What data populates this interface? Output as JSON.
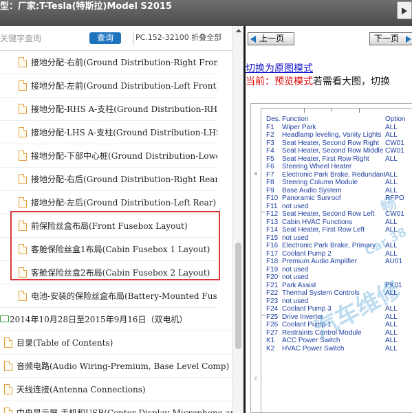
{
  "topbar": {
    "model_text": "型：厂家:T-Tesla(特斯拉)Model S2015"
  },
  "search": {
    "placeholder": "关键字查询",
    "button_label": "查询",
    "pc_info": "PC.152-32100 折叠全部"
  },
  "tree": {
    "items": [
      {
        "label": "接地分配-右前(Ground Distribution-Right Front)",
        "icon": "file-icon"
      },
      {
        "label": "接地分配-左前(Ground Distribution-Left Front)",
        "icon": "file-icon"
      },
      {
        "label": "接地分配-RHS A-支柱(Ground Distribution-RHS A)",
        "icon": "file-icon"
      },
      {
        "label": "接地分配-LHS A-支柱(Ground Distribution-LHS A)",
        "icon": "file-icon"
      },
      {
        "label": "接地分配-下部中心桩(Ground Distribution-Lower Ce",
        "icon": "file-icon"
      },
      {
        "label": "接地分配-右后(Ground Distribution-Right Rear)",
        "icon": "file-icon"
      },
      {
        "label": "接地分配-左后(Ground Distribution-Left Rear)",
        "icon": "file-icon"
      },
      {
        "label": "前保险丝盒布局(Front Fusebox Layout)",
        "icon": "file-icon"
      },
      {
        "label": "客舱保险丝盒1布局(Cabin Fusebox 1 Layout)",
        "icon": "file-icon"
      },
      {
        "label": "客舱保险丝盒2布局(Cabin Fusebox 2 Layout)",
        "icon": "file-icon"
      },
      {
        "label": "电池-安装的保险丝盒布局(Battery-Mounted Fusebox",
        "icon": "file-icon"
      },
      {
        "label": "2014年10月28日至2015年9月16日（双电机）",
        "icon": "folder-icon"
      },
      {
        "label": "目录(Table of Contents)",
        "icon": "file-icon"
      },
      {
        "label": "音频电路(Audio Wiring-Premium, Base Level Comp)",
        "icon": "file-icon"
      },
      {
        "label": "天线连接(Antenna Connections)",
        "icon": "file-icon"
      },
      {
        "label": "中央显示屏-手机和USB(Center Display-Microphone and",
        "icon": "file-icon"
      }
    ]
  },
  "pager": {
    "prev_label": "上一页",
    "next_label": "下一页"
  },
  "preview": {
    "switch_link": "切换为原图模式",
    "mode_prefix": "当前：预览模式",
    "mode_suffix": "若需看大图，切换",
    "column_number": "1",
    "row_marker_b": "B",
    "row_marker_c": "C",
    "header": {
      "des": "Des.",
      "function": "Function",
      "option": "Option"
    },
    "fuses": [
      {
        "des": "F1",
        "function": "Wiper Park",
        "option": "ALL"
      },
      {
        "des": "F2",
        "function": "Headlamp leveling, Vanity Lights",
        "option": "ALL"
      },
      {
        "des": "F3",
        "function": "Seat Heater, Second Row Right",
        "option": "CW01"
      },
      {
        "des": "F4",
        "function": "Seat Heater, Second Row Middle",
        "option": "CW01"
      },
      {
        "des": "F5",
        "function": "Seat Heater, First Row Right",
        "option": "ALL"
      },
      {
        "des": "F6",
        "function": "Steering Wheel Heater",
        "option": ""
      },
      {
        "des": "F7",
        "function": "Electronic Park Brake, Redundant",
        "option": "ALL"
      },
      {
        "des": "F8",
        "function": "Steering Column Module",
        "option": "ALL"
      },
      {
        "des": "F9",
        "function": "Base Audio System",
        "option": "ALL"
      },
      {
        "des": "F10",
        "function": "Panoramic Sunroof",
        "option": "RFPO"
      },
      {
        "des": "F11",
        "function": "not used",
        "option": ""
      },
      {
        "des": "F12",
        "function": "Seat Heater, Second Row Left",
        "option": "CW01"
      },
      {
        "des": "F13",
        "function": "Cabin HVAC Functions",
        "option": "ALL"
      },
      {
        "des": "F14",
        "function": "Seat Heater, First Row Left",
        "option": "ALL"
      },
      {
        "des": "F15",
        "function": "not used",
        "option": ""
      },
      {
        "des": "F16",
        "function": "Electronic Park Brake, Primary",
        "option": "ALL"
      },
      {
        "des": "F17",
        "function": "Coolant Pump 2",
        "option": "ALL"
      },
      {
        "des": "F18",
        "function": "Premium Audio Amplifier",
        "option": "AU01"
      },
      {
        "des": "F19",
        "function": "not used",
        "option": ""
      },
      {
        "des": "F20",
        "function": "not used",
        "option": ""
      },
      {
        "des": "F21",
        "function": "Park Assist",
        "option": "PK01"
      },
      {
        "des": "F22",
        "function": "Thermal System Controls",
        "option": "ALL"
      },
      {
        "des": "F23",
        "function": "not used",
        "option": ""
      },
      {
        "des": "F24",
        "function": "Coolant Pump 3",
        "option": "ALL"
      },
      {
        "des": "F25",
        "function": "Drive Inverter",
        "option": "ALL"
      },
      {
        "des": "F26",
        "function": "Coolant Pump 1",
        "option": "ALL"
      },
      {
        "des": "F27",
        "function": "Restraints Control Module",
        "option": "ALL"
      },
      {
        "des": "K1",
        "function": "ACC Power Switch",
        "option": "ALL"
      },
      {
        "des": "K2",
        "function": "HVAC Power Switch",
        "option": "ALL"
      }
    ],
    "watermark_1": "畅",
    "watermark_2": "Car 38",
    "watermark_3": "汽车维修"
  },
  "colors": {
    "accent_blue": "#1e73be",
    "highlight_red": "#d9383a",
    "mode_red": "#dd0000",
    "link_blue": "#1a1acc",
    "fuse_text": "#1f3fa0"
  }
}
